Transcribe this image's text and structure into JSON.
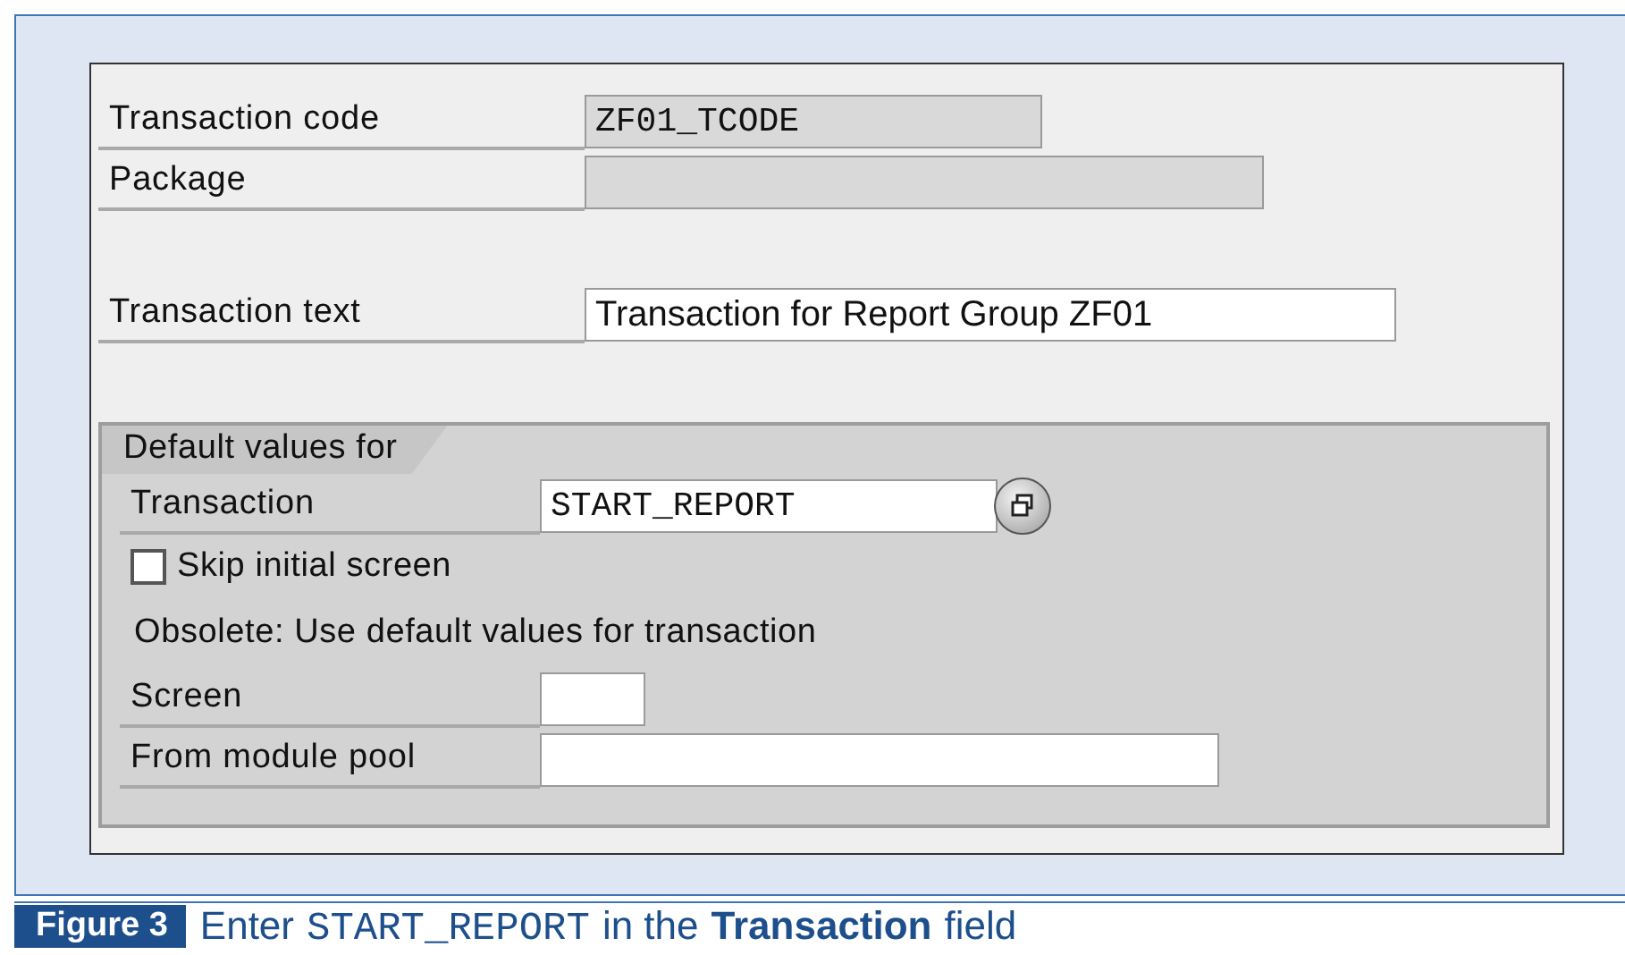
{
  "fields": [
    {
      "label": "Transaction code",
      "value": "ZF01_TCODE",
      "disabled": true
    },
    {
      "label": "Package",
      "disabled": true
    },
    {
      "label": "Transaction text",
      "value": "Transaction for Report Group ZF01",
      "disabled": false
    }
  ],
  "group": {
    "title": "Default values for",
    "items": [
      {
        "kind": "lookup_field",
        "label": "Transaction",
        "value": "START_REPORT",
        "disabled": false
      },
      {
        "kind": "checkbox",
        "label": "Skip initial screen",
        "checked": false
      },
      {
        "kind": "text",
        "label": "Obsolete: Use default values for transaction"
      },
      {
        "kind": "field",
        "label": "Screen",
        "disabled": false
      },
      {
        "kind": "field",
        "label": "From module pool",
        "disabled": false
      }
    ]
  },
  "caption": {
    "number": "Figure 3",
    "parts": [
      {
        "kind": "plain",
        "text": "Enter"
      },
      {
        "kind": "code",
        "text": "START_REPORT"
      },
      {
        "kind": "plain",
        "text": "in the"
      },
      {
        "kind": "bold",
        "text": "Transaction"
      },
      {
        "kind": "plain",
        "text": "field"
      }
    ]
  }
}
